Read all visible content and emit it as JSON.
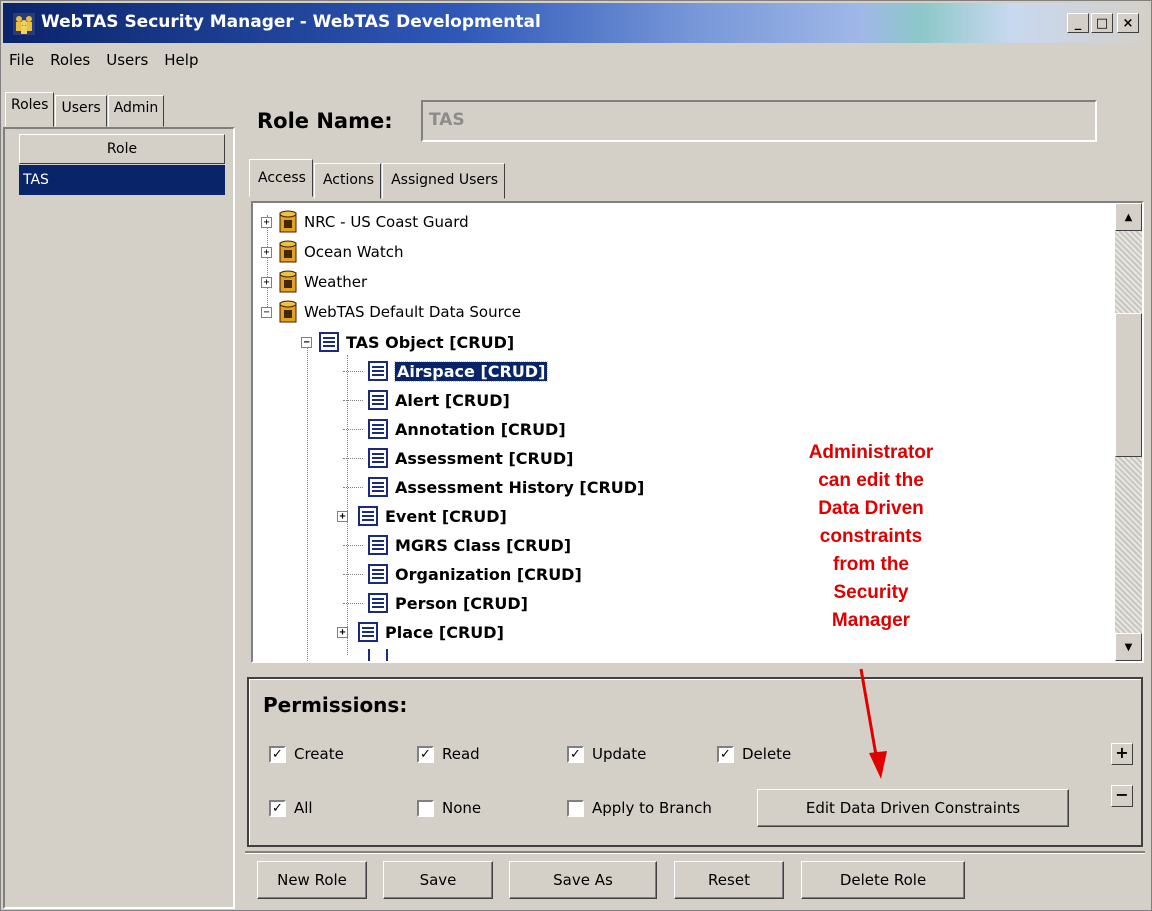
{
  "window": {
    "title": "WebTAS Security Manager - WebTAS Developmental",
    "title_icon": "people-icon"
  },
  "title_buttons": {
    "minimize": "_",
    "maximize": "□",
    "close": "×"
  },
  "menu": [
    "File",
    "Roles",
    "Users",
    "Help"
  ],
  "left_tabs": [
    "Roles",
    "Users",
    "Admin"
  ],
  "role_list": {
    "header": "Role",
    "rows": [
      "TAS"
    ]
  },
  "role_name": {
    "label": "Role Name:",
    "value": "TAS"
  },
  "right_tabs": [
    "Access",
    "Actions",
    "Assigned Users"
  ],
  "tree": {
    "data_sources": [
      "NRC - US Coast Guard",
      "Ocean Watch",
      "Weather",
      "WebTAS Default Data Source"
    ],
    "root_object": "TAS Object [CRUD]",
    "children": [
      "Airspace [CRUD]",
      "Alert [CRUD]",
      "Annotation [CRUD]",
      "Assessment [CRUD]",
      "Assessment History [CRUD]",
      "Event [CRUD]",
      "MGRS Class [CRUD]",
      "Organization [CRUD]",
      "Person [CRUD]",
      "Place [CRUD]"
    ],
    "selected": "Airspace [CRUD]"
  },
  "annotation": [
    "Administrator",
    "can edit the",
    "Data Driven",
    "constraints",
    "from the",
    "Security",
    "Manager"
  ],
  "permissions": {
    "title": "Permissions:",
    "create": {
      "label": "Create",
      "checked": true
    },
    "read": {
      "label": "Read",
      "checked": true
    },
    "update": {
      "label": "Update",
      "checked": true
    },
    "delete": {
      "label": "Delete",
      "checked": true
    },
    "all": {
      "label": "All",
      "checked": true
    },
    "none": {
      "label": "None",
      "checked": false
    },
    "apply_branch": {
      "label": "Apply to Branch",
      "checked": false
    },
    "edit_constraints": "Edit Data Driven Constraints",
    "plus": "+",
    "minus": "−"
  },
  "bottom_buttons": [
    "New Role",
    "Save",
    "Save As",
    "Reset",
    "Delete Role"
  ],
  "colors": {
    "accent": "#0a246a",
    "annotation": "#e00000",
    "face": "#d4d0c8"
  }
}
